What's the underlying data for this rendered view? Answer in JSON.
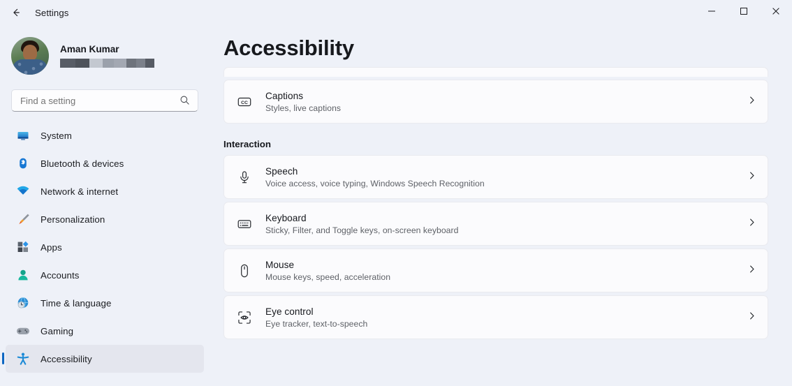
{
  "window": {
    "back_icon": "back-arrow-icon",
    "title": "Settings",
    "controls": {
      "minimize": "minimize-icon",
      "maximize": "maximize-icon",
      "close": "close-icon"
    }
  },
  "sidebar": {
    "profile": {
      "name": "Aman Kumar",
      "email_redacted": true,
      "avatar": "user-avatar"
    },
    "search": {
      "placeholder": "Find a setting",
      "value": "",
      "icon": "search-icon"
    },
    "items": [
      {
        "label": "System",
        "icon": "monitor-icon",
        "selected": false
      },
      {
        "label": "Bluetooth & devices",
        "icon": "bluetooth-icon",
        "selected": false
      },
      {
        "label": "Network & internet",
        "icon": "wifi-icon",
        "selected": false
      },
      {
        "label": "Personalization",
        "icon": "paintbrush-icon",
        "selected": false
      },
      {
        "label": "Apps",
        "icon": "apps-grid-icon",
        "selected": false
      },
      {
        "label": "Accounts",
        "icon": "person-icon",
        "selected": false
      },
      {
        "label": "Time & language",
        "icon": "globe-clock-icon",
        "selected": false
      },
      {
        "label": "Gaming",
        "icon": "gamepad-icon",
        "selected": false
      },
      {
        "label": "Accessibility",
        "icon": "accessibility-icon",
        "selected": true
      }
    ]
  },
  "main": {
    "page_title": "Accessibility",
    "cards_above": [
      {
        "title": "Captions",
        "subtitle": "Styles, live captions",
        "icon": "closed-caption-icon",
        "chevron": "chevron-right-icon"
      }
    ],
    "sections": [
      {
        "heading": "Interaction",
        "cards": [
          {
            "title": "Speech",
            "subtitle": "Voice access, voice typing, Windows Speech Recognition",
            "icon": "microphone-icon",
            "chevron": "chevron-right-icon"
          },
          {
            "title": "Keyboard",
            "subtitle": "Sticky, Filter, and Toggle keys, on-screen keyboard",
            "icon": "keyboard-icon",
            "chevron": "chevron-right-icon"
          },
          {
            "title": "Mouse",
            "subtitle": "Mouse keys, speed, acceleration",
            "icon": "mouse-icon",
            "chevron": "chevron-right-icon"
          },
          {
            "title": "Eye control",
            "subtitle": "Eye tracker, text-to-speech",
            "icon": "eye-control-icon",
            "chevron": "chevron-right-icon"
          }
        ]
      }
    ]
  },
  "colors": {
    "page_background": "#eef1f8",
    "card_background": "#fbfbfd",
    "accent": "#0d66c2",
    "selected_row": "#e4e6ee",
    "text_primary": "#16181d",
    "text_secondary": "#5e6167"
  }
}
